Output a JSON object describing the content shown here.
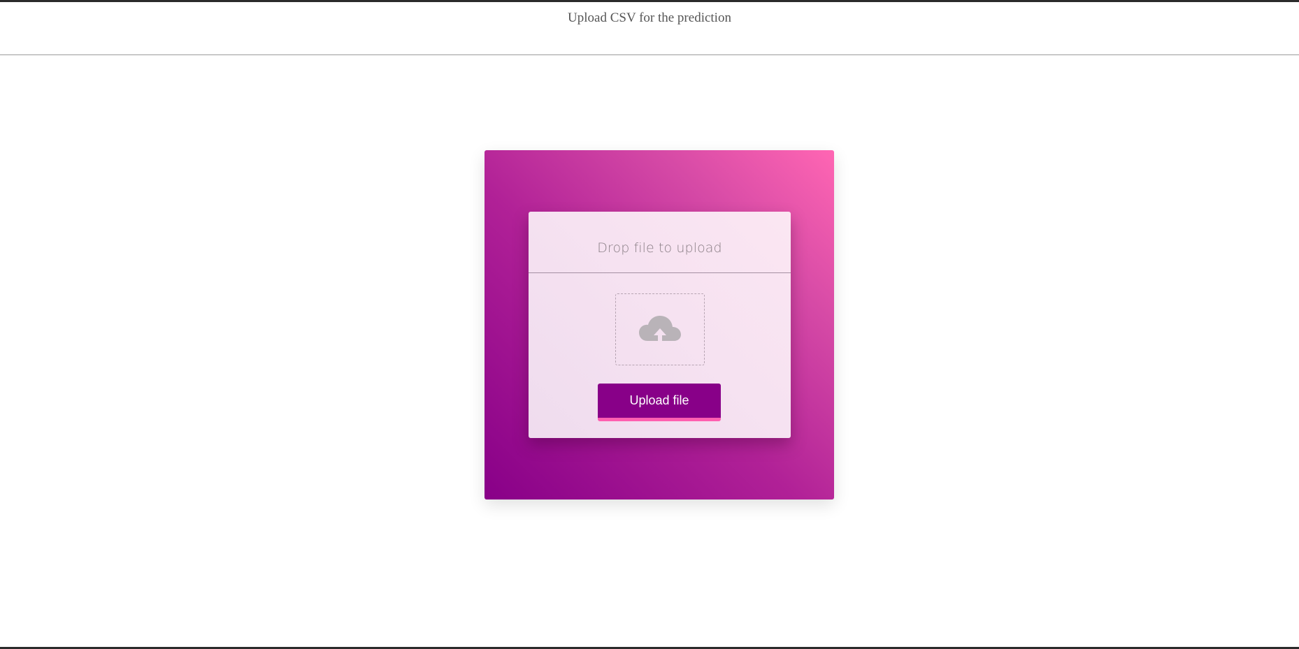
{
  "header": {
    "title": "Upload CSV for the prediction"
  },
  "uploader": {
    "title": "Drop file to upload",
    "icon": "cloud-upload-icon",
    "button_label": "Upload file"
  },
  "colors": {
    "brand": "#880088",
    "accent": "#ff66b3",
    "button_underline": "#ff5fb0"
  }
}
